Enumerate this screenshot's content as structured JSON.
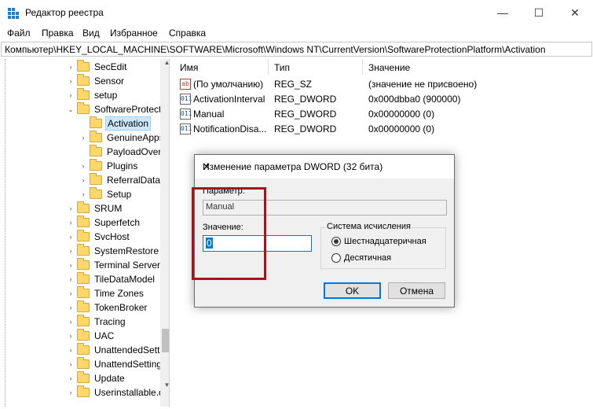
{
  "window": {
    "title": "Редактор реестра",
    "minimize_glyph": "—",
    "maximize_glyph": "☐",
    "close_glyph": "✕"
  },
  "menu": {
    "items": [
      {
        "label": "Файл"
      },
      {
        "label": "Правка"
      },
      {
        "label": "Вид"
      },
      {
        "label": "Избранное"
      },
      {
        "label": "Справка"
      }
    ]
  },
  "address": {
    "path": "Компьютер\\HKEY_LOCAL_MACHINE\\SOFTWARE\\Microsoft\\Windows NT\\CurrentVersion\\SoftwareProtectionPlatform\\Activation"
  },
  "tree": {
    "items": [
      {
        "label": "SecEdit",
        "expander": "›"
      },
      {
        "label": "Sensor",
        "expander": "›"
      },
      {
        "label": "setup",
        "expander": "›"
      },
      {
        "label": "SoftwareProtecti",
        "expander": "⌄"
      },
      {
        "label": "Activation",
        "expander": ""
      },
      {
        "label": "GenuineApps",
        "expander": "›"
      },
      {
        "label": "PayloadOverr",
        "expander": ""
      },
      {
        "label": "Plugins",
        "expander": "›"
      },
      {
        "label": "ReferralData",
        "expander": "›"
      },
      {
        "label": "Setup",
        "expander": "›"
      },
      {
        "label": "SRUM",
        "expander": "›"
      },
      {
        "label": "Superfetch",
        "expander": "›"
      },
      {
        "label": "SvcHost",
        "expander": "›"
      },
      {
        "label": "SystemRestore",
        "expander": "›"
      },
      {
        "label": "Terminal Server",
        "expander": "›"
      },
      {
        "label": "TileDataModel",
        "expander": "›"
      },
      {
        "label": "Time Zones",
        "expander": "›"
      },
      {
        "label": "TokenBroker",
        "expander": "›"
      },
      {
        "label": "Tracing",
        "expander": "›"
      },
      {
        "label": "UAC",
        "expander": "›"
      },
      {
        "label": "UnattendedSetti",
        "expander": "›"
      },
      {
        "label": "UnattendSetting",
        "expander": "›"
      },
      {
        "label": "Update",
        "expander": "›"
      },
      {
        "label": "Userinstallable.d",
        "expander": "›"
      }
    ],
    "selected_label": "Activation",
    "scroll_up_glyph": "▲",
    "scroll_down_glyph": "▼"
  },
  "values": {
    "columns": [
      "Имя",
      "Тип",
      "Значение"
    ],
    "rows": [
      {
        "name": "(По умолчанию)",
        "type": "REG_SZ",
        "data": "(значение не присвоено)",
        "icon": "ab",
        "icon_name": "reg-sz-icon"
      },
      {
        "name": "ActivationInterval",
        "type": "REG_DWORD",
        "data": "0x000dbba0 (900000)",
        "icon": "011",
        "icon_name": "reg-dword-icon"
      },
      {
        "name": "Manual",
        "type": "REG_DWORD",
        "data": "0x00000000 (0)",
        "icon": "011",
        "icon_name": "reg-dword-icon"
      },
      {
        "name": "NotificationDisa...",
        "type": "REG_DWORD",
        "data": "0x00000000 (0)",
        "icon": "011",
        "icon_name": "reg-dword-icon"
      }
    ]
  },
  "dialog": {
    "title": "Изменение параметра DWORD (32 бита)",
    "close_glyph": "✕",
    "name_label": "Параметр:",
    "name_value": "Manual",
    "value_label": "Значение:",
    "value_data": "0",
    "base_group_label": "Система исчисления",
    "radio_hex": "Шестнадцатеричная",
    "radio_dec": "Десятичная",
    "selected_base": "hex",
    "ok_label": "OK",
    "cancel_label": "Отмена"
  },
  "colors": {
    "accent": "#0078d7",
    "highlight_box": "#a2161b",
    "selection": "#cce8ff"
  }
}
